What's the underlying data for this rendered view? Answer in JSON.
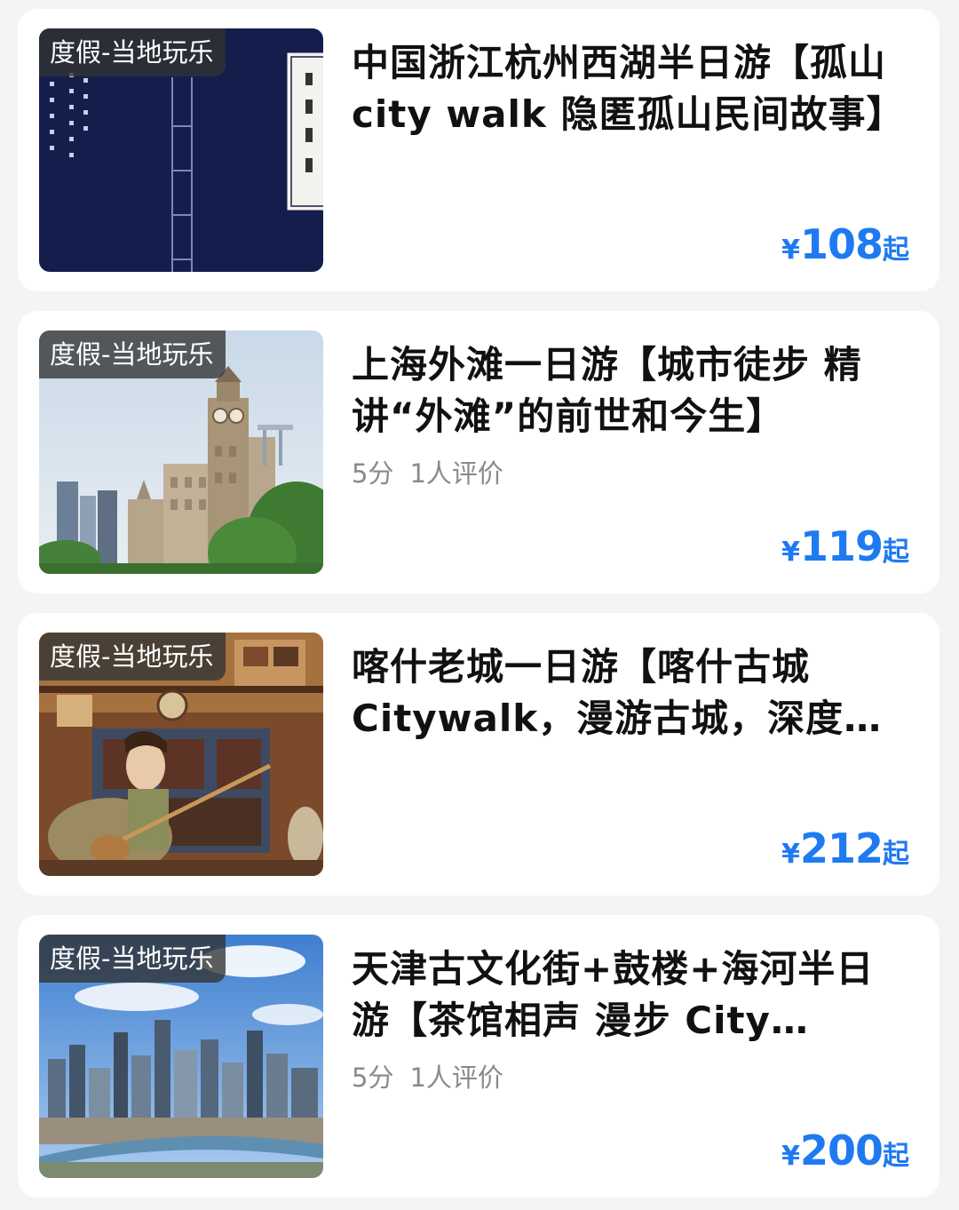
{
  "accent_color": "#1f7af2",
  "items": [
    {
      "tag": "度假-当地玩乐",
      "title": "中国浙江杭州西湖半日游【孤山city walk 隐匿孤山民间故事】",
      "rating": "",
      "reviews": "",
      "currency": "¥",
      "price": "108",
      "price_suffix": "起",
      "image": "book-cover-image"
    },
    {
      "tag": "度假-当地玩乐",
      "title": "上海外滩一日游【城市徒步 精讲“外滩”的前世和今生】",
      "rating": "5分",
      "reviews": "1人评价",
      "currency": "¥",
      "price": "119",
      "price_suffix": "起",
      "image": "bund-clock-tower-image"
    },
    {
      "tag": "度假-当地玩乐",
      "title": "喀什老城一日游【喀什古城Citywalk，漫游古城，深度体验】",
      "rating": "",
      "reviews": "",
      "currency": "¥",
      "price": "212",
      "price_suffix": "起",
      "image": "kashgar-musician-image"
    },
    {
      "tag": "度假-当地玩乐",
      "title": "天津古文化街+鼓楼+海河半日游【茶馆相声 漫步 City Walk】",
      "rating": "5分",
      "reviews": "1人评价",
      "currency": "¥",
      "price": "200",
      "price_suffix": "起",
      "image": "tianjin-skyline-image"
    }
  ]
}
